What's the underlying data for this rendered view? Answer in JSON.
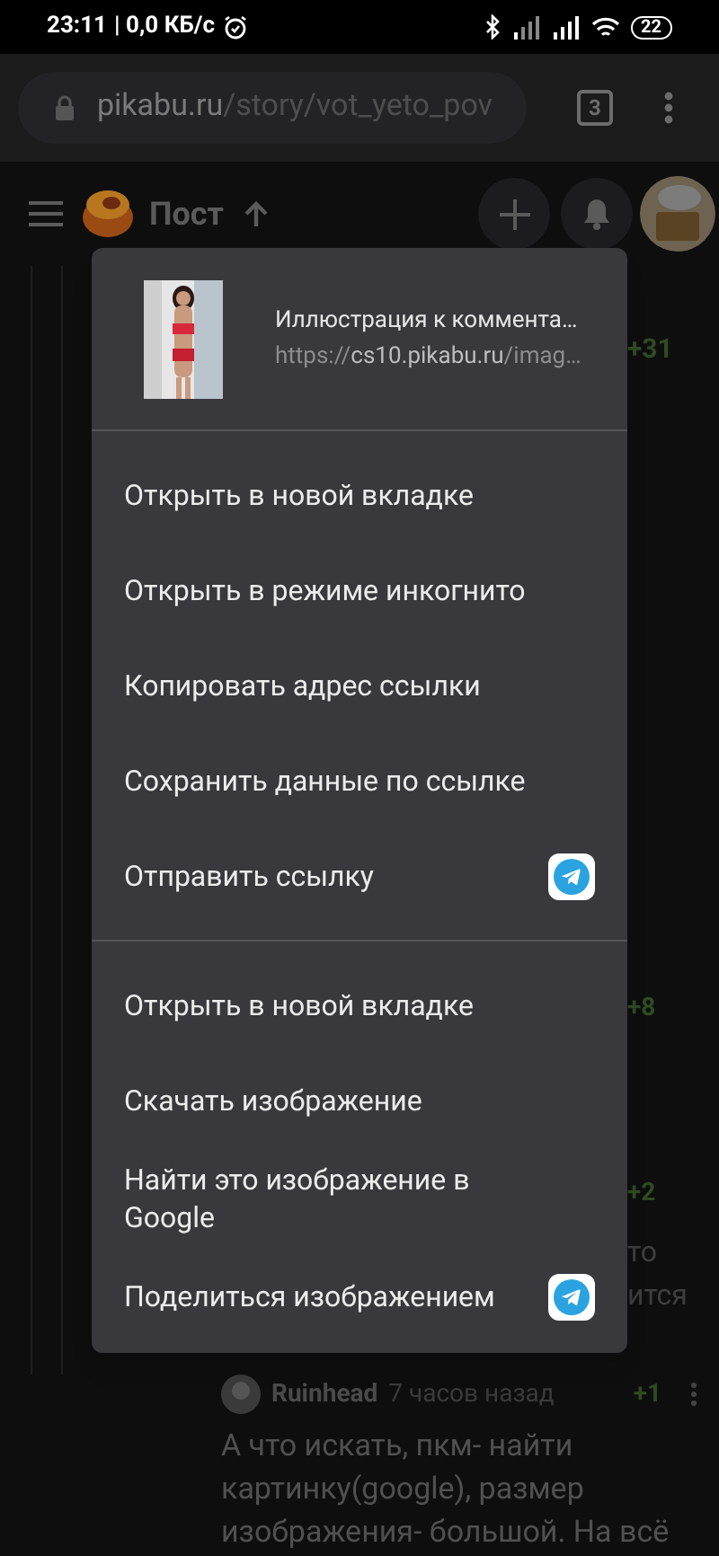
{
  "status_bar": {
    "time": "23:11",
    "speed": "| 0,0 КБ/с",
    "battery": "22"
  },
  "browser": {
    "url_host": "pikabu.ru",
    "url_path": "/story/vot_yeto_pov",
    "tab_count": "3"
  },
  "page_header": {
    "title": "Пост"
  },
  "background": {
    "votes": [
      {
        "text": "+31"
      },
      {
        "text": "+8"
      },
      {
        "text": "+2"
      }
    ],
    "fragments": [
      "то",
      "ится"
    ],
    "comment": {
      "author": "Ruinhead",
      "time": "7 часов назад",
      "vote": "+1",
      "text": "А что искать, пкм- найти картинку(google), размер изображения- большой. На всё"
    }
  },
  "context_menu": {
    "title": "Иллюстрация к коммента…",
    "url_scheme": "https://",
    "url_host": "cs10.pikabu.ru",
    "url_path": "/imag…",
    "groups": [
      [
        {
          "label": "Открыть в новой вкладке",
          "kind": "plain"
        },
        {
          "label": "Открыть в режиме инкогнито",
          "kind": "plain"
        },
        {
          "label": "Копировать адрес ссылки",
          "kind": "plain"
        },
        {
          "label": "Сохранить данные по ссылке",
          "kind": "plain"
        },
        {
          "label": "Отправить ссылку",
          "kind": "share"
        }
      ],
      [
        {
          "label": "Открыть в новой вкладке",
          "kind": "plain"
        },
        {
          "label": "Скачать изображение",
          "kind": "plain"
        },
        {
          "label": "Найти это изображение в Google",
          "kind": "plain"
        },
        {
          "label": "Поделиться изображением",
          "kind": "share"
        }
      ]
    ]
  }
}
